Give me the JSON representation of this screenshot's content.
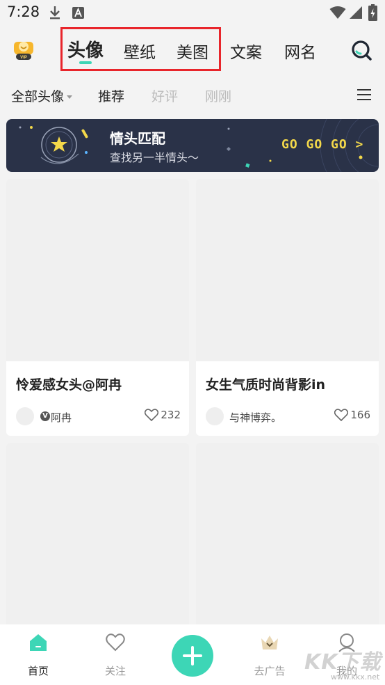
{
  "status_bar": {
    "time": "7:28"
  },
  "header": {
    "tabs": [
      {
        "label": "头像",
        "active": true
      },
      {
        "label": "壁纸",
        "active": false
      },
      {
        "label": "美图",
        "active": false
      },
      {
        "label": "文案",
        "active": false
      },
      {
        "label": "网名",
        "active": false
      }
    ],
    "vip_badge": "VIP"
  },
  "filters": {
    "dropdown": "全部头像",
    "items": [
      "推荐",
      "好评",
      "刚刚"
    ]
  },
  "banner": {
    "title": "情头匹配",
    "subtitle": "查找另一半情头～",
    "cta": "GO GO GO >"
  },
  "cards": [
    {
      "title": "怜爱感女头@阿冉",
      "author": "阿冉",
      "verified": true,
      "likes": "232"
    },
    {
      "title": "女生气质时尚背影in",
      "author": "与神博弈。",
      "verified": false,
      "likes": "166"
    }
  ],
  "bottom_nav": {
    "items": [
      {
        "label": "首页",
        "icon": "home-icon",
        "active": true
      },
      {
        "label": "关注",
        "icon": "heart-icon",
        "active": false
      },
      {
        "label": "去广告",
        "icon": "crown-icon",
        "active": false
      },
      {
        "label": "我的",
        "icon": "profile-icon",
        "active": false
      }
    ]
  },
  "watermark": {
    "text": "KK下载",
    "url": "www.kkx.net"
  },
  "colors": {
    "accent": "#3dd6b6",
    "highlight": "#e8252b",
    "banner_bg": "#2a3248",
    "banner_cta": "#f3d84a"
  }
}
